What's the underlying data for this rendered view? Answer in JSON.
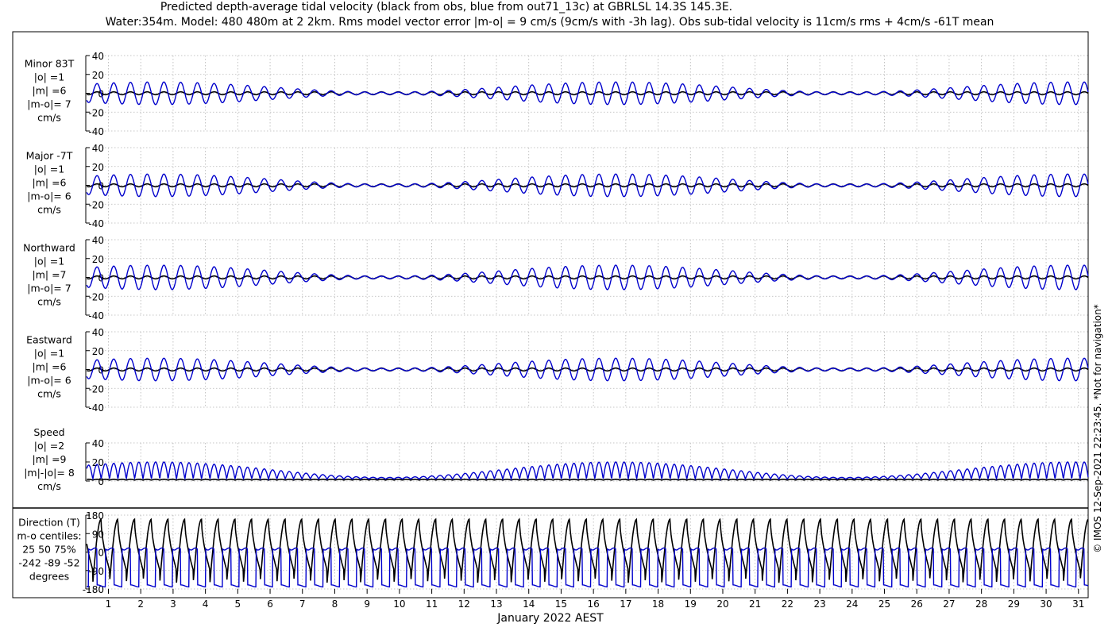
{
  "title_line1": "Predicted depth-average tidal velocity (black from obs, blue from out71_13c) at GBRLSL 14.3S 145.3E.",
  "title_line2": "Water:354m. Model: 480 480m at 2 2km. Rms model vector error |m-o| = 9 cm/s (9cm/s with -3h lag). Obs sub-tidal velocity is 11cm/s rms + 4cm/s -61T mean",
  "xlabel": "January 2022 AEST",
  "watermark": "© IMOS 12-Sep-2021 22:23:45. *Not for navigation*",
  "colors": {
    "obs": "#000000",
    "model": "#0000cc",
    "grid": "#b4b4b4"
  },
  "chart_data": [
    {
      "type": "line",
      "panel": "minor",
      "label_lines": [
        "Minor 83T",
        "|o| =1",
        "|m| =6",
        "|m-o|= 7",
        "cm/s"
      ],
      "ylim": [
        -40,
        40
      ],
      "yticks": [
        40,
        20,
        0,
        -20,
        -40
      ],
      "ytick_labels": [
        "40",
        "20",
        "0",
        "-20",
        "-40"
      ],
      "grid": true,
      "series": [
        {
          "role": "obs",
          "amplitude": 1.5
        },
        {
          "role": "model",
          "amplitude": 12
        }
      ]
    },
    {
      "type": "line",
      "panel": "major",
      "label_lines": [
        "Major -7T",
        "|o| =1",
        "|m| =6",
        "|m-o|= 6",
        "cm/s"
      ],
      "ylim": [
        -40,
        40
      ],
      "yticks": [
        40,
        20,
        0,
        -20,
        -40
      ],
      "ytick_labels": [
        "40",
        "20",
        "0",
        "-20",
        "-40"
      ],
      "grid": true,
      "series": [
        {
          "role": "obs",
          "amplitude": 1.5
        },
        {
          "role": "model",
          "amplitude": 12
        }
      ]
    },
    {
      "type": "line",
      "panel": "northward",
      "label_lines": [
        "Northward",
        "|o| =1",
        "|m| =7",
        "|m-o|= 7",
        "cm/s"
      ],
      "ylim": [
        -40,
        40
      ],
      "yticks": [
        40,
        20,
        0,
        -20,
        -40
      ],
      "ytick_labels": [
        "40",
        "20",
        "0",
        "-20",
        "-40"
      ],
      "grid": true,
      "series": [
        {
          "role": "obs",
          "amplitude": 1.5
        },
        {
          "role": "model",
          "amplitude": 13
        }
      ]
    },
    {
      "type": "line",
      "panel": "eastward",
      "label_lines": [
        "Eastward",
        "|o| =1",
        "|m| =6",
        "|m-o|= 6",
        "cm/s"
      ],
      "ylim": [
        -40,
        40
      ],
      "yticks": [
        40,
        20,
        0,
        -20,
        -40
      ],
      "ytick_labels": [
        "40",
        "20",
        "0",
        "-20",
        "-40"
      ],
      "grid": true,
      "series": [
        {
          "role": "obs",
          "amplitude": 1.5
        },
        {
          "role": "model",
          "amplitude": 12
        }
      ]
    },
    {
      "type": "line",
      "panel": "speed",
      "label_lines": [
        "Speed",
        "|o| =2",
        "|m| =9",
        "|m|-|o|= 8",
        "cm/s"
      ],
      "ylim": [
        0,
        40
      ],
      "yticks": [
        40,
        20,
        0
      ],
      "ytick_labels": [
        "40",
        "20",
        "0"
      ],
      "grid": true,
      "series": [
        {
          "role": "obs",
          "amplitude": 2
        },
        {
          "role": "model",
          "amplitude": 18
        }
      ]
    },
    {
      "type": "line",
      "panel": "direction",
      "label_lines": [
        "Direction (T)",
        "m-o centiles:",
        "25  50  75%",
        "-242  -89  -52",
        "degrees"
      ],
      "ylim": [
        -180,
        180
      ],
      "yticks": [
        180,
        90,
        0,
        -90,
        -180
      ],
      "ytick_labels": [
        "180",
        "90",
        "0",
        "-90",
        "-180"
      ],
      "grid": true,
      "series": [
        {
          "role": "obs"
        },
        {
          "role": "model"
        }
      ]
    }
  ],
  "x_axis": {
    "xlim": [
      0.3,
      31.3
    ],
    "ticks": [
      1,
      2,
      3,
      4,
      5,
      6,
      7,
      8,
      9,
      10,
      11,
      12,
      13,
      14,
      15,
      16,
      17,
      18,
      19,
      20,
      21,
      22,
      23,
      24,
      25,
      26,
      27,
      28,
      29,
      30,
      31
    ],
    "tick_labels": [
      "1",
      "2",
      "3",
      "4",
      "5",
      "6",
      "7",
      "8",
      "9",
      "10",
      "11",
      "12",
      "13",
      "14",
      "15",
      "16",
      "17",
      "18",
      "19",
      "20",
      "21",
      "22",
      "23",
      "24",
      "25",
      "26",
      "27",
      "28",
      "29",
      "30",
      "31"
    ]
  }
}
